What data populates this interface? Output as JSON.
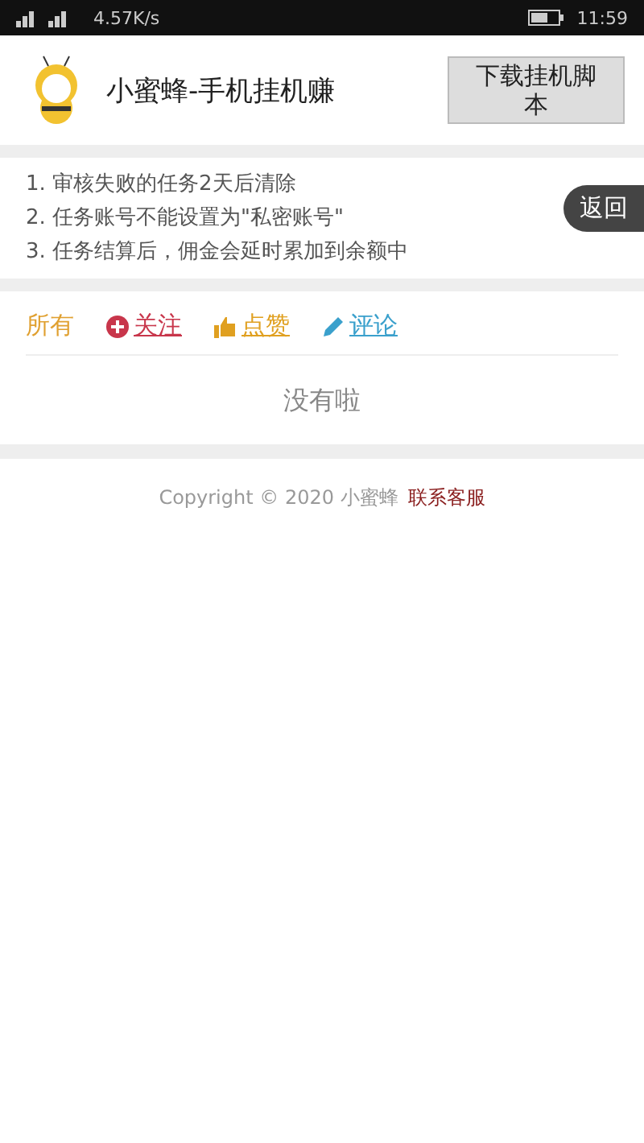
{
  "status_bar": {
    "speed": "4.57K/s",
    "time": "11:59"
  },
  "header": {
    "title": "小蜜蜂-手机挂机赚",
    "download_button": "下载挂机脚本"
  },
  "notices": [
    "1. 审核失败的任务2天后清除",
    "2. 任务账号不能设置为\"私密账号\"",
    "3. 任务结算后，佣金会延时累加到余额中"
  ],
  "back_button": "返回",
  "filters": [
    {
      "kind": "all",
      "label": "所有",
      "selected": true,
      "color": "#e0a030"
    },
    {
      "kind": "follow",
      "label": "关注",
      "selected": false,
      "color": "#c8364b"
    },
    {
      "kind": "like",
      "label": "点赞",
      "selected": false,
      "color": "#e0a020"
    },
    {
      "kind": "comment",
      "label": "评论",
      "selected": false,
      "color": "#3aa0cc"
    }
  ],
  "empty_message": "没有啦",
  "footer": {
    "copyright": "Copyright © 2020 小蜜蜂",
    "contact_link": "联系客服"
  }
}
